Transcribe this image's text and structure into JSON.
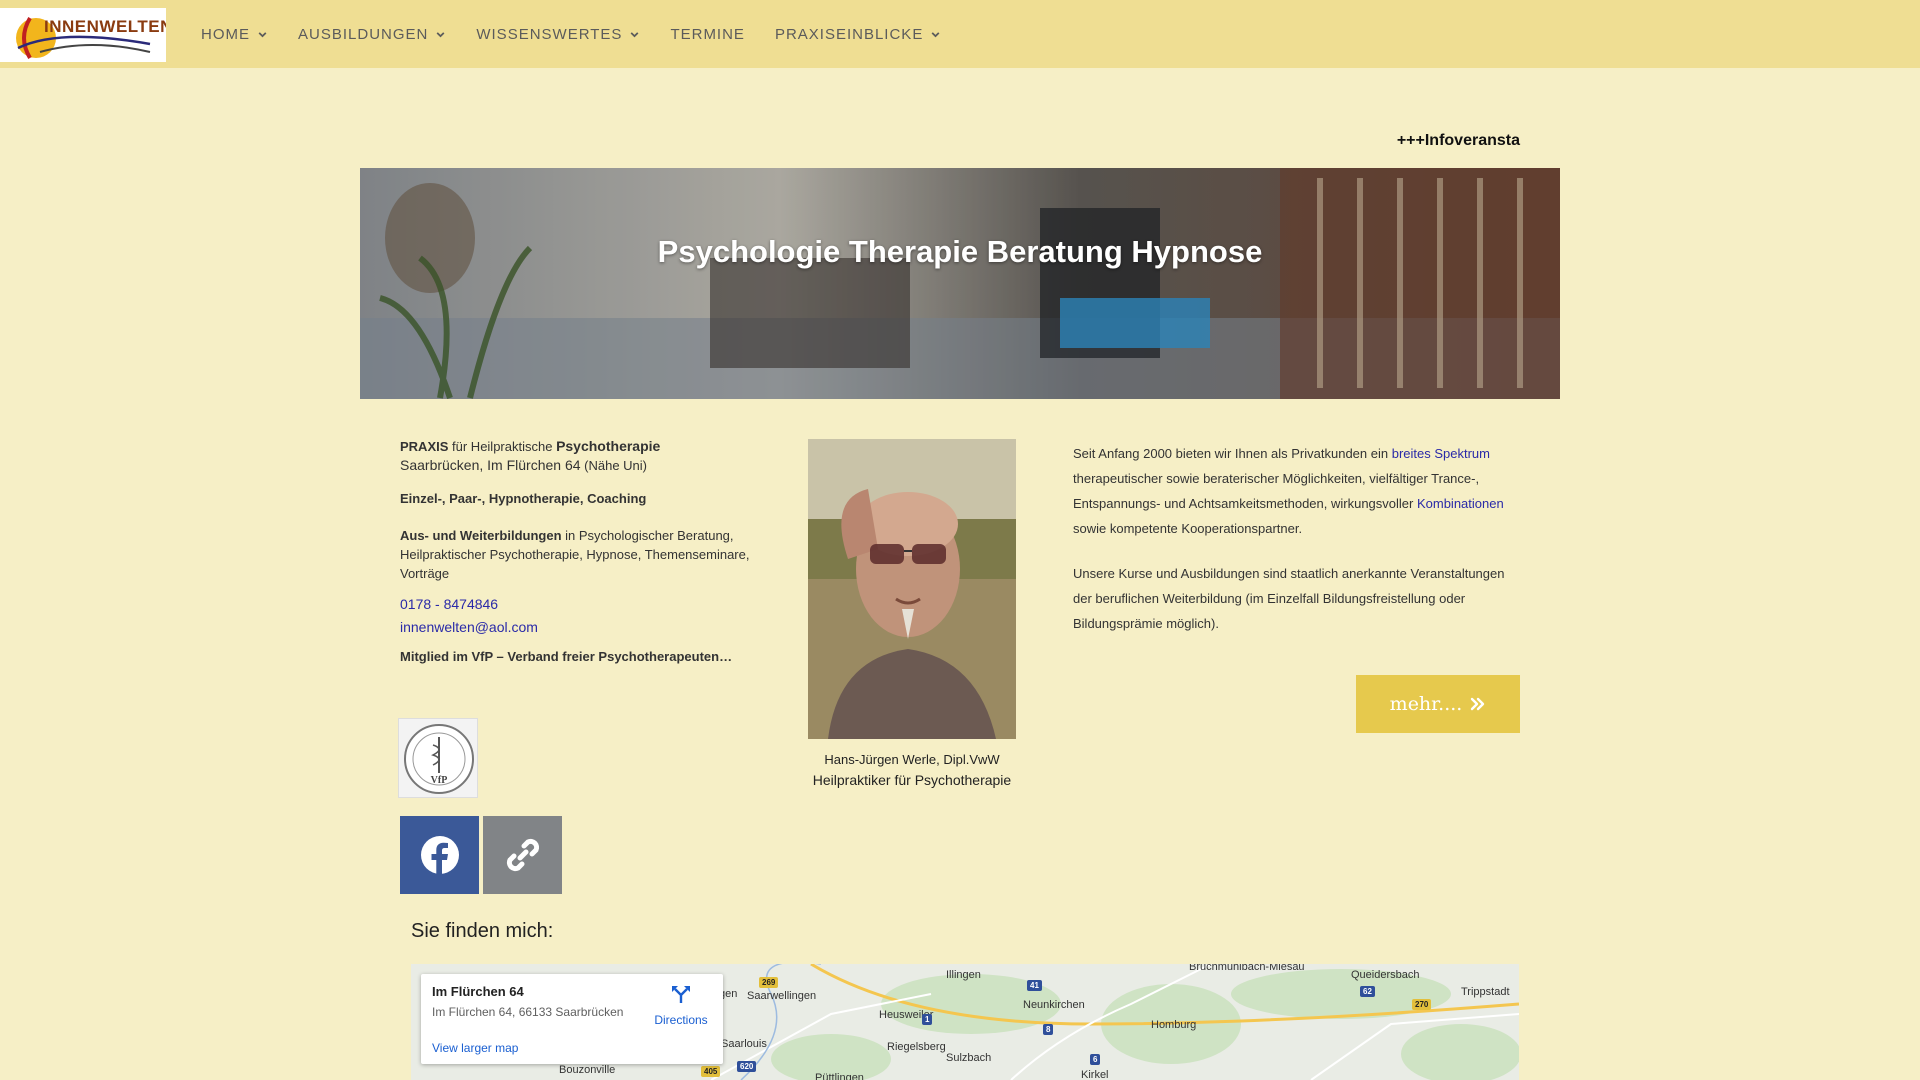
{
  "header": {
    "logo_text": "INNENWELTEN",
    "nav": [
      {
        "label": "HOME"
      },
      {
        "label": "AUSBILDUNGEN"
      },
      {
        "label": "WISSENSWERTES"
      },
      {
        "label": "TERMINE"
      },
      {
        "label": "PRAXISEINBLICKE"
      }
    ]
  },
  "ticker": "+++Infoveransta",
  "hero": {
    "title": "Psychologie Therapie Beratung Hypnose"
  },
  "left": {
    "praxis_bold": "PRAXIS",
    "praxis_mid": " für Heilpraktische ",
    "praxis_big": "Psychotherapie",
    "address": "Saarbrücken, Im Flürchen 64",
    "address_note": " (Nähe Uni)",
    "services": "Einzel-, Paar-, Hypnotherapie, Coaching",
    "training_bold": "Aus- und Weiterbildungen",
    "training_rest": " in Psychologischer Beratung, Heilpraktischer Psychotherapie, Hypnose, Themenseminare, Vorträge",
    "phone": "0178 - 8474846",
    "email": "innenwelten@aol.com",
    "membership": "Mitglied im VfP – Verband freier Psychotherapeuten…",
    "badge_text": "VfP"
  },
  "portrait": {
    "caption_line1": "Hans-Jürgen Werle, Dipl.VwW",
    "caption_line2": "Heilpraktiker für Psychotherapie"
  },
  "right": {
    "p1_a": "Seit Anfang 2000 bieten wir Ihnen als Privatkunden ein ",
    "p1_link1": "breites Spektrum",
    "p1_b": " therapeutischer sowie beraterischer Möglichkeiten, vielfältiger Trance-, Entspannungs- und Achtsamkeitsmethoden, wirkungsvoller ",
    "p1_link2": "Kombinationen",
    "p1_c": " sowie kompetente Kooperationspartner.",
    "p2": "Unsere Kurse und Ausbildungen sind staatlich anerkannte Veranstaltungen der beruflichen Weiterbildung  (im Einzelfall Bildungsfreistellung oder Bildungsprämie möglich).",
    "more_button": "mehr...."
  },
  "find_me": "Sie finden mich:",
  "map": {
    "place_title": "Im Flürchen 64",
    "place_address": "Im Flürchen 64, 66133 Saarbrücken",
    "directions": "Directions",
    "view_larger": "View larger map",
    "towns": [
      "Illingen",
      "Neunkirchen",
      "Queidersbach",
      "Trippstadt",
      "Saarwellingen",
      "Heusweiler",
      "Homburg",
      "Riegelsberg",
      "Sulzbach",
      "Saarlouis",
      "Bouzonville",
      "Püttlingen",
      "Kirkel",
      "Bruchmühlbach-Miesau",
      "gen"
    ],
    "roads": [
      "269",
      "41",
      "62",
      "270",
      "1",
      "8",
      "6",
      "620",
      "405"
    ]
  },
  "colors": {
    "header_bg": "#efde93",
    "page_bg": "#f6efc6",
    "button_bg": "#e6c94d",
    "facebook": "#3b5998",
    "link": "#2a2aa8"
  }
}
